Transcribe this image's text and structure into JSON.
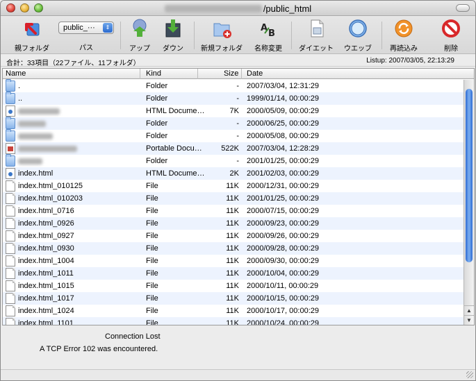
{
  "window": {
    "title": "/public_html"
  },
  "toolbar": {
    "items": [
      {
        "label": "親フォルダ",
        "icon": "parent-folder-icon"
      },
      {
        "label": "パス",
        "icon": "path-icon"
      },
      {
        "label": "アップ",
        "icon": "upload-icon"
      },
      {
        "label": "ダウン",
        "icon": "download-icon"
      },
      {
        "label": "新規フォルダ",
        "icon": "new-folder-icon"
      },
      {
        "label": "名称変更",
        "icon": "rename-icon"
      },
      {
        "label": "ダイエット",
        "icon": "diet-icon"
      },
      {
        "label": "ウエッブ",
        "icon": "web-icon"
      },
      {
        "label": "再読込み",
        "icon": "reload-icon"
      },
      {
        "label": "削除",
        "icon": "delete-icon"
      }
    ],
    "path_value": "public_···"
  },
  "info": {
    "summary": "合計：33項目（22ファイル、11フォルダ）",
    "listup": "Listup: 2007/03/05, 22:13:29"
  },
  "columns": {
    "name": "Name",
    "kind": "Kind",
    "size": "Size",
    "date": "Date"
  },
  "files": [
    {
      "name": ".",
      "kind": "Folder",
      "size": "-",
      "date": "2007/03/04, 12:31:29",
      "icon": "folder"
    },
    {
      "name": "..",
      "kind": "Folder",
      "size": "-",
      "date": "1999/01/14, 00:00:29",
      "icon": "folder"
    },
    {
      "name": "",
      "kind": "HTML Docume…",
      "size": "7K",
      "date": "2000/05/09, 00:00:29",
      "icon": "html"
    },
    {
      "name": "",
      "kind": "Folder",
      "size": "-",
      "date": "2000/06/25, 00:00:29",
      "icon": "folder"
    },
    {
      "name": "",
      "kind": "Folder",
      "size": "-",
      "date": "2000/05/08, 00:00:29",
      "icon": "folder"
    },
    {
      "name": "",
      "kind": "Portable Docu…",
      "size": "522K",
      "date": "2007/03/04, 12:28:29",
      "icon": "pdf"
    },
    {
      "name": "",
      "kind": "Folder",
      "size": "-",
      "date": "2001/01/25, 00:00:29",
      "icon": "folder"
    },
    {
      "name": "index.html",
      "kind": "HTML Docume…",
      "size": "2K",
      "date": "2001/02/03, 00:00:29",
      "icon": "html"
    },
    {
      "name": "index.html_010125",
      "kind": "File",
      "size": "11K",
      "date": "2000/12/31, 00:00:29",
      "icon": "file"
    },
    {
      "name": "index.html_010203",
      "kind": "File",
      "size": "11K",
      "date": "2001/01/25, 00:00:29",
      "icon": "file"
    },
    {
      "name": "index.html_0716",
      "kind": "File",
      "size": "11K",
      "date": "2000/07/15, 00:00:29",
      "icon": "file"
    },
    {
      "name": "index.html_0926",
      "kind": "File",
      "size": "11K",
      "date": "2000/09/23, 00:00:29",
      "icon": "file"
    },
    {
      "name": "index.html_0927",
      "kind": "File",
      "size": "11K",
      "date": "2000/09/26, 00:00:29",
      "icon": "file"
    },
    {
      "name": "index.html_0930",
      "kind": "File",
      "size": "11K",
      "date": "2000/09/28, 00:00:29",
      "icon": "file"
    },
    {
      "name": "index.html_1004",
      "kind": "File",
      "size": "11K",
      "date": "2000/09/30, 00:00:29",
      "icon": "file"
    },
    {
      "name": "index.html_1011",
      "kind": "File",
      "size": "11K",
      "date": "2000/10/04, 00:00:29",
      "icon": "file"
    },
    {
      "name": "index.html_1015",
      "kind": "File",
      "size": "11K",
      "date": "2000/10/11, 00:00:29",
      "icon": "file"
    },
    {
      "name": "index.html_1017",
      "kind": "File",
      "size": "11K",
      "date": "2000/10/15, 00:00:29",
      "icon": "file"
    },
    {
      "name": "index.html_1024",
      "kind": "File",
      "size": "11K",
      "date": "2000/10/17, 00:00:29",
      "icon": "file"
    },
    {
      "name": "index.html_1101",
      "kind": "File",
      "size": "11K",
      "date": "2000/10/24, 00:00:29",
      "icon": "file"
    }
  ],
  "status": {
    "title": "Connection Lost",
    "detail": "A TCP Error 102 was encountered."
  },
  "colors": {
    "row_alt": "#edf3fe",
    "scroll_thumb": "#2d6ad2",
    "traffic_close": "#e0443a",
    "traffic_min": "#e8b43a",
    "traffic_max": "#69bd3c"
  }
}
